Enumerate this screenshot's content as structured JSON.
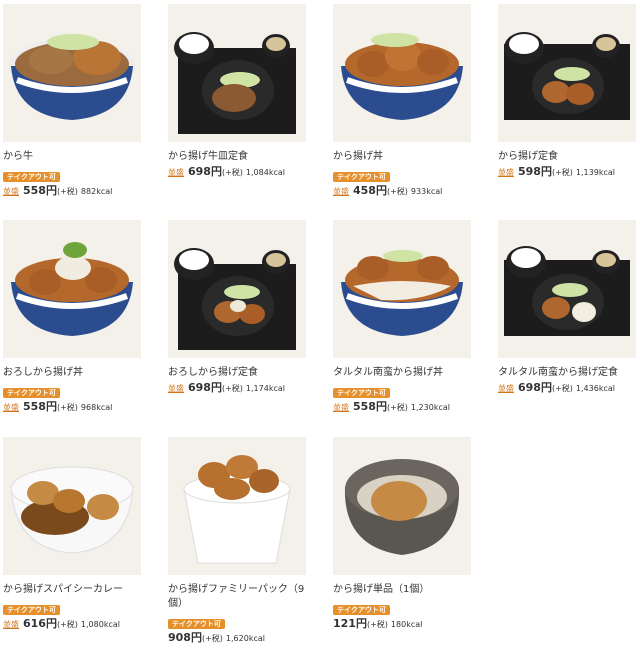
{
  "items": [
    {
      "name": "から牛",
      "takeout": "テイクアウト可",
      "size": "並盛",
      "price": "558円",
      "tax": "(+税)",
      "kcal": "882kcal",
      "photo": "bowl-beef-karaage",
      "colors": {
        "food": "#b87535",
        "bowl": "#2b4d8f"
      }
    },
    {
      "name": "から揚げ牛皿定食",
      "takeout": "",
      "size": "並盛",
      "price": "698円",
      "tax": "(+税)",
      "kcal": "1,084kcal",
      "photo": "set-meal-beef",
      "colors": {
        "food": "#8c5a32",
        "bowl": "#222"
      }
    },
    {
      "name": "から揚げ丼",
      "takeout": "テイクアウト可",
      "size": "並盛",
      "price": "458円",
      "tax": "(+税)",
      "kcal": "933kcal",
      "photo": "bowl-karaage",
      "colors": {
        "food": "#b5682c",
        "bowl": "#2b4d8f"
      }
    },
    {
      "name": "から揚げ定食",
      "takeout": "",
      "size": "並盛",
      "price": "598円",
      "tax": "(+税)",
      "kcal": "1,139kcal",
      "photo": "set-meal-karaage",
      "colors": {
        "food": "#b0672e",
        "bowl": "#222"
      }
    },
    {
      "name": "おろしから揚げ丼",
      "takeout": "テイクアウト可",
      "size": "並盛",
      "price": "558円",
      "tax": "(+税)",
      "kcal": "968kcal",
      "photo": "bowl-oroshi-karaage",
      "colors": {
        "food": "#b5682c",
        "bowl": "#2b4d8f"
      }
    },
    {
      "name": "おろしから揚げ定食",
      "takeout": "",
      "size": "並盛",
      "price": "698円",
      "tax": "(+税)",
      "kcal": "1,174kcal",
      "photo": "set-meal-oroshi",
      "colors": {
        "food": "#b0672e",
        "bowl": "#222"
      }
    },
    {
      "name": "タルタル南蛮から揚げ丼",
      "takeout": "テイクアウト可",
      "size": "並盛",
      "price": "558円",
      "tax": "(+税)",
      "kcal": "1,230kcal",
      "photo": "bowl-tartar-karaage",
      "colors": {
        "food": "#b5682c",
        "bowl": "#2b4d8f"
      }
    },
    {
      "name": "タルタル南蛮から揚げ定食",
      "takeout": "",
      "size": "並盛",
      "price": "698円",
      "tax": "(+税)",
      "kcal": "1,436kcal",
      "photo": "set-meal-tartar",
      "colors": {
        "food": "#b0672e",
        "bowl": "#222"
      }
    },
    {
      "name": "から揚げスパイシーカレー",
      "takeout": "テイクアウト可",
      "size": "並盛",
      "price": "616円",
      "tax": "(+税)",
      "kcal": "1,080kcal",
      "photo": "curry-karaage",
      "colors": {
        "food": "#c1833e",
        "bowl": "#f5f5f5"
      }
    },
    {
      "name": "から揚げファミリーパック（9個）",
      "takeout": "テイクアウト可",
      "size": "",
      "price": "908円",
      "tax": "(+税)",
      "kcal": "1,620kcal",
      "photo": "family-pack",
      "colors": {
        "food": "#b8702f",
        "bowl": "#ffffff"
      }
    },
    {
      "name": "から揚げ単品（1個）",
      "takeout": "テイクアウト可",
      "size": "",
      "price": "121円",
      "tax": "(+税)",
      "kcal": "180kcal",
      "photo": "single-karaage",
      "colors": {
        "food": "#c58a44",
        "bowl": "#5a5650"
      }
    }
  ]
}
